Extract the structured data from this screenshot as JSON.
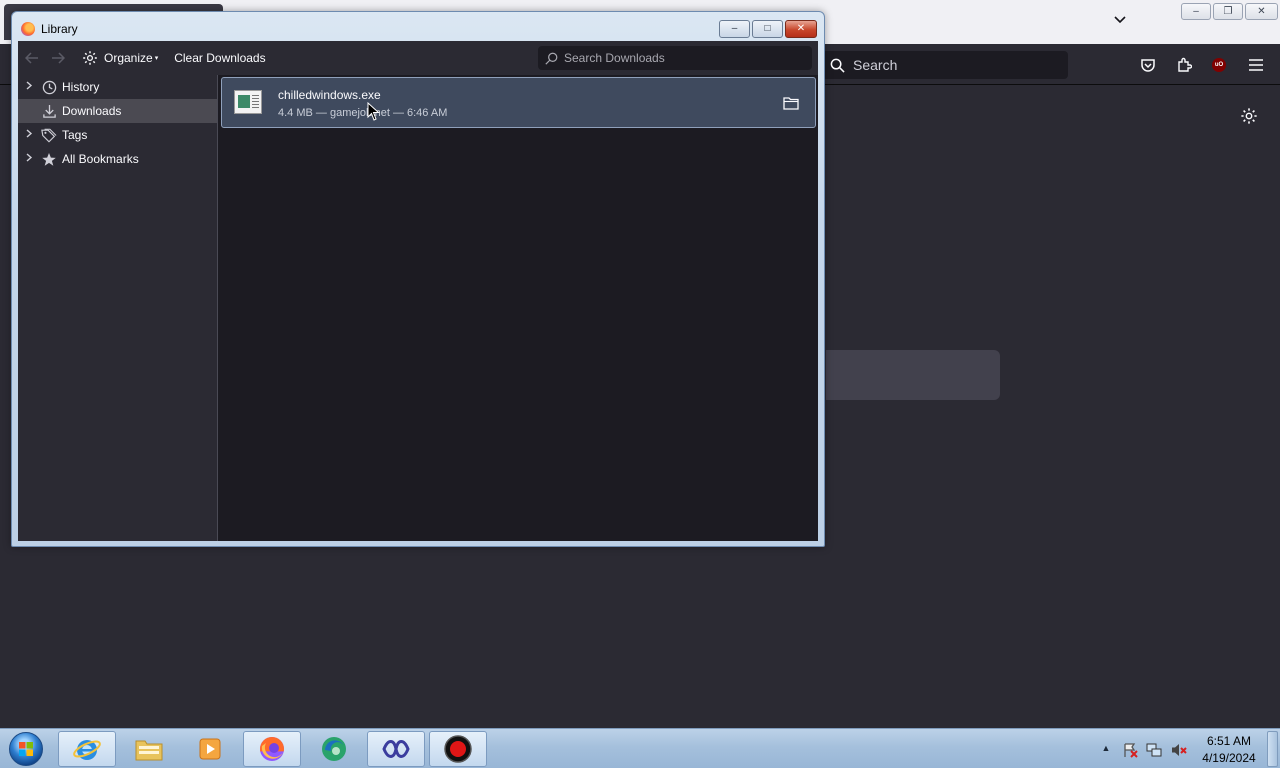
{
  "browser": {
    "search_placeholder": "Search",
    "list_tabs_icon": "chevron-down-icon",
    "toolbar_icons": [
      "pocket-icon",
      "extensions-icon",
      "ublock-icon",
      "menu-icon"
    ],
    "ublock_badge": "uO",
    "settings_icon": "gear-icon"
  },
  "library": {
    "title": "Library",
    "window_controls": {
      "minimize": "–",
      "maximize": "□",
      "close": "✕"
    },
    "toolbar": {
      "back_icon": "arrow-left-icon",
      "forward_icon": "arrow-right-icon",
      "organize_label": "Organize",
      "clear_downloads_label": "Clear Downloads",
      "search_placeholder": "Search Downloads"
    },
    "sidebar": {
      "items": [
        {
          "label": "History",
          "icon": "clock-icon",
          "expandable": true
        },
        {
          "label": "Downloads",
          "icon": "download-icon",
          "expandable": false,
          "selected": true
        },
        {
          "label": "Tags",
          "icon": "tag-icon",
          "expandable": true
        },
        {
          "label": "All Bookmarks",
          "icon": "star-icon",
          "expandable": true
        }
      ]
    },
    "downloads": [
      {
        "filename": "chilledwindows.exe",
        "status": "4.4 MB — gamejolt.net — 6:46 AM",
        "action_icon": "folder-icon"
      }
    ]
  },
  "taskbar": {
    "apps": [
      "start-orb",
      "internet-explorer-icon",
      "file-explorer-icon",
      "media-player-icon",
      "firefox-icon",
      "edge-icon",
      "visual-studio-icon",
      "record-icon"
    ],
    "clock": {
      "time": "6:51 AM",
      "date": "4/19/2024"
    }
  },
  "colors": {
    "browser_bg": "#2b2a33",
    "content_bg": "#1c1b22",
    "selection_bg": "#3f4a5e",
    "taskbar": "#a5c0dc"
  }
}
